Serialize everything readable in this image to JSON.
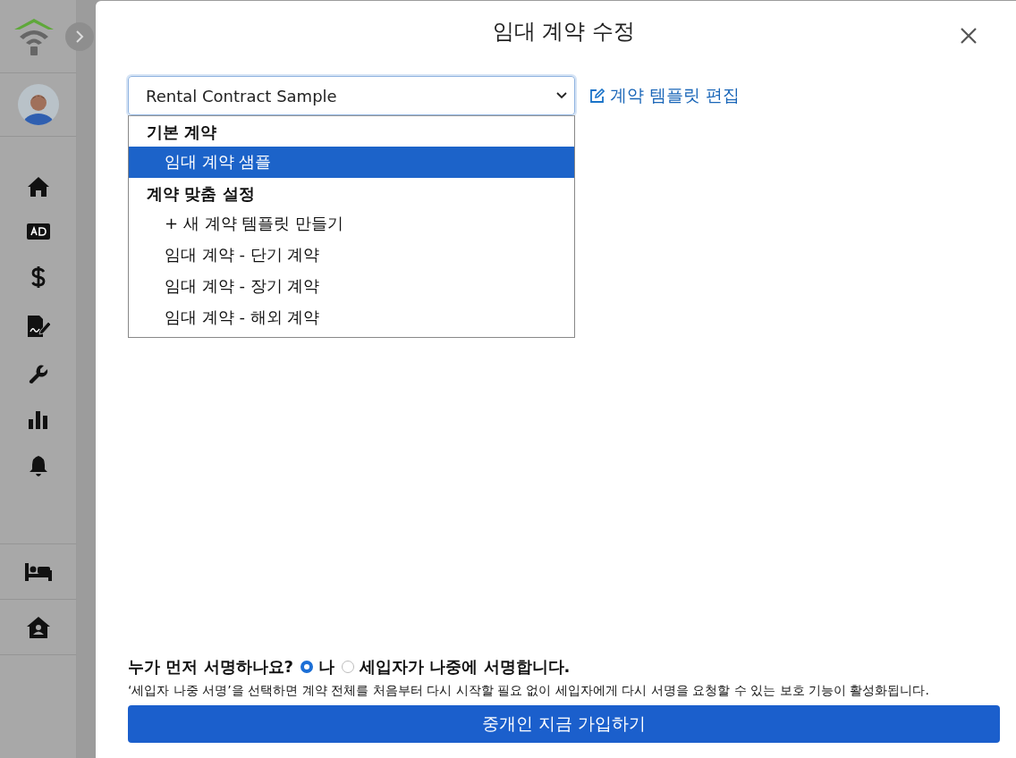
{
  "dialog": {
    "title": "임대 계약 수정",
    "template_select": {
      "value": "Rental Contract Sample"
    },
    "edit_link": "계약 템플릿 편집",
    "dropdown": {
      "groups": [
        {
          "label": "기본 계약",
          "options": [
            {
              "label": "임대 계약 샘플",
              "selected": true
            }
          ]
        },
        {
          "label": "계약 맞춤 설정",
          "options": [
            {
              "label": "+ 새 계약 템플릿 만들기",
              "selected": false
            },
            {
              "label": "임대 계약 - 단기 계약",
              "selected": false
            },
            {
              "label": "임대 계약 - 장기 계약",
              "selected": false
            },
            {
              "label": "임대 계약 - 해외 계약",
              "selected": false
            }
          ]
        }
      ]
    },
    "signing": {
      "question": "누가 먼저 서명하나요?",
      "options": [
        {
          "label": "나",
          "selected": true
        },
        {
          "label": "세입자가 나중에 서명합니다.",
          "selected": false
        }
      ],
      "note": "‘세입자 나중 서명’을 선택하면 계약 전체를 처음부터 다시 시작할 필요 없이 세입자에게 다시 서명을 요청할 수 있는 보호 기능이 활성화됩니다."
    },
    "submit_button": "중개인 지금 가입하기"
  }
}
